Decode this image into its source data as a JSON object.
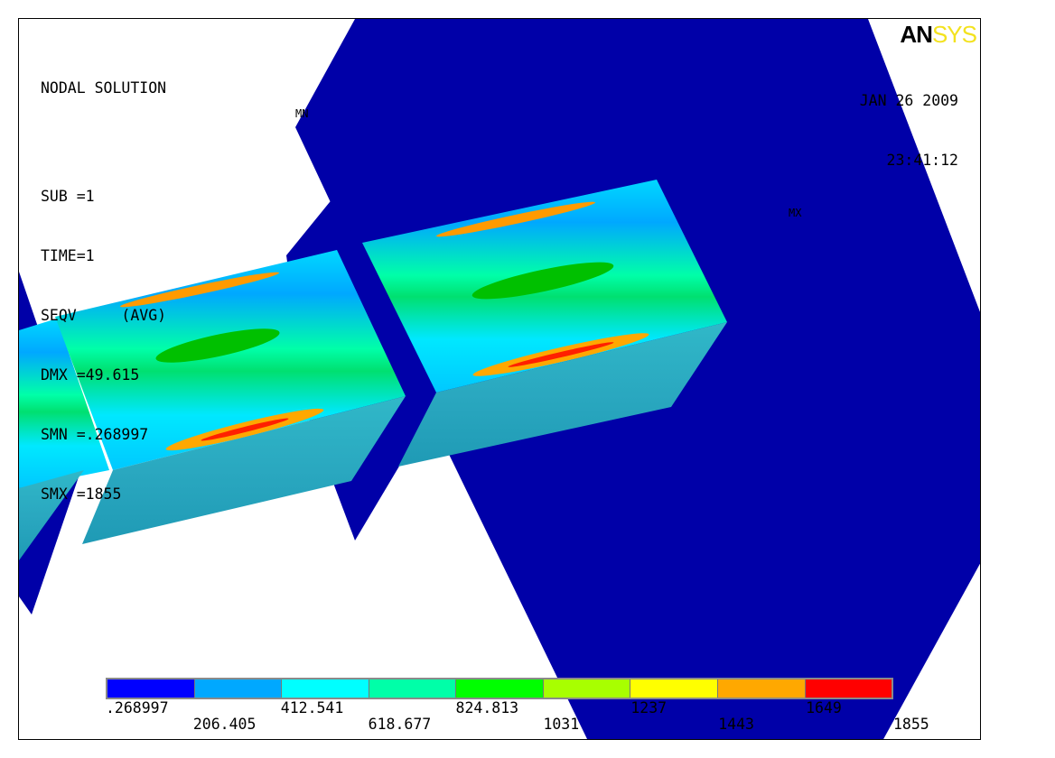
{
  "logo": {
    "an": "AN",
    "sys": "SYS"
  },
  "info": {
    "title": "NODAL SOLUTION",
    "sub": "SUB =1",
    "time": "TIME=1",
    "seqv": "SEQV     (AVG)",
    "dmx": "DMX =49.615",
    "smn": "SMN =.268997",
    "smx": "SMX =1855"
  },
  "date": "JAN 26 2009",
  "time_of_day": "23:41:12",
  "markers": {
    "min": "MN",
    "max": "MX"
  },
  "legend": {
    "colors": [
      "#0000ff",
      "#00a8ff",
      "#00ffff",
      "#00ffa8",
      "#00ff00",
      "#a8ff00",
      "#ffff00",
      "#ffa800",
      "#ff0000"
    ],
    "labels_top": [
      ".268997",
      "412.541",
      "824.813",
      "1237",
      "1649"
    ],
    "labels_bottom": [
      "206.405",
      "618.677",
      "1031",
      "1443",
      "1855"
    ]
  }
}
